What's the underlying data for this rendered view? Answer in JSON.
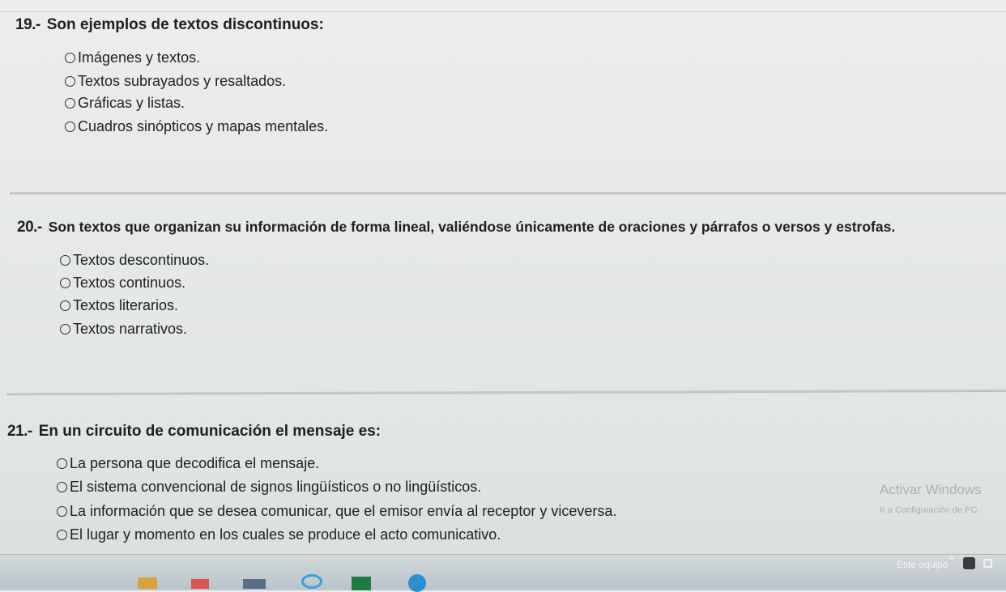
{
  "questions": [
    {
      "number": "19.-",
      "text": "Son ejemplos de textos discontinuos:",
      "options": [
        "Imágenes y textos.",
        "Textos subrayados y resaltados.",
        "Gráficas y listas.",
        "Cuadros sinópticos y mapas mentales."
      ]
    },
    {
      "number": "20.-",
      "text": "Son textos que organizan su información de forma lineal, valiéndose únicamente de oraciones y párrafos o versos y estrofas.",
      "options": [
        "Textos descontinuos.",
        "Textos continuos.",
        "Textos literarios.",
        "Textos narrativos."
      ]
    },
    {
      "number": "21.-",
      "text": "En un circuito de comunicación el mensaje es:",
      "options": [
        "La persona que decodifica el mensaje.",
        "El sistema convencional de signos lingüísticos o no lingüísticos.",
        "La información que se desea comunicar, que el emisor envía al receptor y viceversa.",
        "El lugar y momento en los cuales se produce el acto comunicativo."
      ]
    }
  ],
  "watermark": {
    "title": "Activar Windows",
    "subtitle": "Ir a Configuración de PC"
  },
  "taskbar": {
    "label": "Este equipo",
    "chevron": "»",
    "icons": [
      "file-explorer-icon",
      "windows-store-icon",
      "calculator-icon",
      "internet-explorer-icon",
      "excel-icon",
      "chrome-icon",
      "notification-icon",
      "network-icon"
    ]
  },
  "colors": {
    "background": "#e6e9e8",
    "text": "#1d1f22",
    "watermark": "#a9b0b4",
    "taskbar": "#c3ccd1"
  }
}
